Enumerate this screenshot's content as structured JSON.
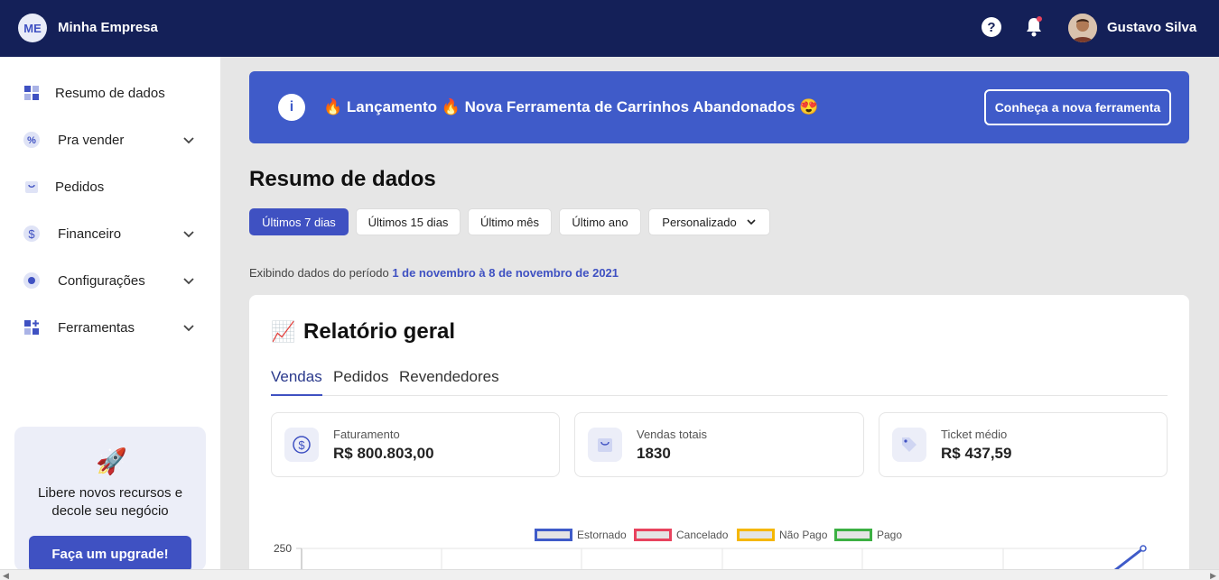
{
  "header": {
    "brand_initials": "ME",
    "brand_name": "Minha Empresa",
    "help_glyph": "?",
    "user_name": "Gustavo Silva"
  },
  "sidebar": {
    "items": [
      {
        "label": "Resumo de dados",
        "icon": "dashboard-icon",
        "expandable": false
      },
      {
        "label": "Pra vender",
        "icon": "percent-icon",
        "expandable": true
      },
      {
        "label": "Pedidos",
        "icon": "bag-icon",
        "expandable": false
      },
      {
        "label": "Financeiro",
        "icon": "dollar-icon",
        "expandable": true
      },
      {
        "label": "Configurações",
        "icon": "gear-icon",
        "expandable": true
      },
      {
        "label": "Ferramentas",
        "icon": "tools-icon",
        "expandable": true
      }
    ],
    "promo": {
      "icon": "rocket-icon",
      "text": "Libere novos recursos e decole seu negócio",
      "button": "Faça um upgrade!"
    }
  },
  "banner": {
    "info_glyph": "i",
    "message": "🔥 Lançamento 🔥 Nova Ferramenta de Carrinhos Abandonados 😍",
    "cta": "Conheça a nova ferramenta"
  },
  "page": {
    "title": "Resumo de dados",
    "filters": [
      "Últimos 7 dias",
      "Últimos 15 dias",
      "Último mês",
      "Último ano",
      "Personalizado"
    ],
    "active_filter": 0,
    "period_prefix": "Exibindo dados do período",
    "period_range": "1 de novembro à 8 de novembro de 2021"
  },
  "report": {
    "title_icon": "📈",
    "title": "Relatório geral",
    "tabs": [
      "Vendas",
      "Pedidos",
      "Revendedores"
    ],
    "active_tab": 0,
    "stats": [
      {
        "label": "Faturamento",
        "value": "R$ 800.803,00",
        "icon": "dollar-icon"
      },
      {
        "label": "Vendas totais",
        "value": "1830",
        "icon": "bag-icon"
      },
      {
        "label": "Ticket médio",
        "value": "R$ 437,59",
        "icon": "tag-icon"
      }
    ]
  },
  "colors": {
    "primary": "#3f51c2",
    "topbar": "#142058",
    "banner": "#3f5bc9",
    "estornado": "#3f5bc9",
    "cancelado": "#e8435e",
    "nao_pago": "#f5b700",
    "pago": "#3cb043"
  },
  "chart_data": {
    "type": "line",
    "legend": [
      "Estornado",
      "Cancelado",
      "Não Pago",
      "Pago"
    ],
    "y_ticks_visible": [
      "250"
    ],
    "series": [
      {
        "name": "Estornado",
        "values": [
          250
        ]
      }
    ]
  }
}
